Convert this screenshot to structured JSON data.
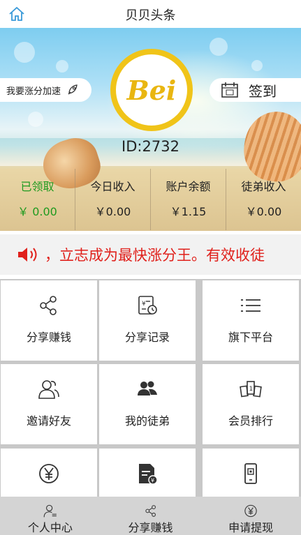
{
  "header": {
    "title": "贝贝头条",
    "home_icon": "home-icon"
  },
  "hero": {
    "accelerate_label": "我要涨分加速",
    "checkin_label": "签到",
    "logo_text": "Bei",
    "user_id": "ID:2732",
    "stats": [
      {
        "label": "已领取",
        "value": "￥ 0.00",
        "active": true
      },
      {
        "label": "今日收入",
        "value": "￥0.00"
      },
      {
        "label": "账户余额",
        "value": "￥1.15"
      },
      {
        "label": "徒弟收入",
        "value": "￥0.00"
      }
    ]
  },
  "announcement": {
    "text": "，立志成为最快涨分王。有效收徒"
  },
  "menu": [
    {
      "label": "分享赚钱",
      "icon": "share-icon"
    },
    {
      "label": "分享记录",
      "icon": "record-icon"
    },
    {
      "label": "旗下平台",
      "icon": "list-icon"
    },
    {
      "label": "邀请好友",
      "icon": "invite-icon"
    },
    {
      "label": "我的徒弟",
      "icon": "disciples-icon"
    },
    {
      "label": "会员排行",
      "icon": "ranking-icon"
    },
    {
      "label": "",
      "icon": "yen-icon"
    },
    {
      "label": "",
      "icon": "bill-icon"
    },
    {
      "label": "",
      "icon": "phone-qr-icon"
    }
  ],
  "tabbar": [
    {
      "label": "个人中心",
      "icon": "user-icon"
    },
    {
      "label": "分享赚钱",
      "icon": "share-icon"
    },
    {
      "label": "申请提现",
      "icon": "withdraw-icon"
    }
  ],
  "colors": {
    "accent_red": "#e0211c",
    "active_green": "#1f9a1f",
    "logo_gold": "#f0c419"
  }
}
